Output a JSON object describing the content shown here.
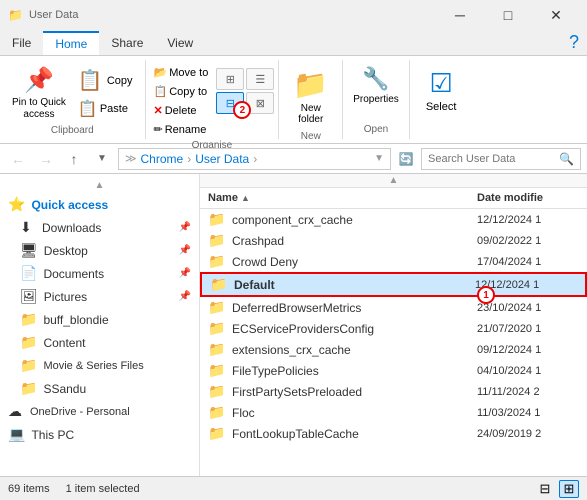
{
  "titleBar": {
    "title": "User Data",
    "quickAccessIcon": "📁",
    "controls": {
      "minimize": "─",
      "maximize": "□",
      "close": "✕"
    }
  },
  "ribbonTabs": [
    "File",
    "Home",
    "Share",
    "View"
  ],
  "activeTab": "Home",
  "ribbon": {
    "groups": [
      {
        "name": "clipboard",
        "label": "Clipboard",
        "buttons": [
          {
            "id": "pin-to-quick",
            "label": "Pin to Quick\naccess",
            "icon": "📌"
          },
          {
            "id": "copy",
            "label": "Copy",
            "icon": "📋"
          },
          {
            "id": "paste",
            "label": "Paste",
            "icon": "📋"
          }
        ]
      },
      {
        "name": "organise",
        "label": "Organise"
      },
      {
        "name": "new",
        "label": "New",
        "buttons": [
          {
            "id": "new-folder",
            "label": "New\nfolder",
            "icon": "📁"
          }
        ]
      },
      {
        "name": "open",
        "label": "Open",
        "buttons": [
          {
            "id": "properties",
            "label": "Properties",
            "icon": "🔧"
          }
        ]
      },
      {
        "name": "select",
        "label": "",
        "buttons": [
          {
            "id": "select-btn",
            "label": "Select",
            "icon": "☑"
          }
        ]
      }
    ]
  },
  "addressBar": {
    "path": [
      "Chrome",
      "User Data"
    ],
    "searchPlaceholder": "Search User Data",
    "searchIcon": "🔍"
  },
  "sidebar": {
    "items": [
      {
        "id": "quick-access",
        "label": "Quick access",
        "icon": "⭐",
        "type": "header",
        "expanded": true
      },
      {
        "id": "downloads",
        "label": "Downloads",
        "icon": "⬇",
        "pinned": true
      },
      {
        "id": "desktop",
        "label": "Desktop",
        "icon": "🖥",
        "pinned": true
      },
      {
        "id": "documents",
        "label": "Documents",
        "icon": "📄",
        "pinned": true
      },
      {
        "id": "pictures",
        "label": "Pictures",
        "icon": "🖼",
        "pinned": true
      },
      {
        "id": "buff-blondie",
        "label": "buff_blondie",
        "icon": "📁",
        "pinned": false
      },
      {
        "id": "content",
        "label": "Content",
        "icon": "📁",
        "pinned": false
      },
      {
        "id": "movie-series",
        "label": "Movie & Series Files",
        "icon": "📁",
        "pinned": false
      },
      {
        "id": "ssandu",
        "label": "SSandu",
        "icon": "📁",
        "pinned": false
      },
      {
        "id": "onedrive",
        "label": "OneDrive - Personal",
        "icon": "☁",
        "type": "header"
      },
      {
        "id": "this-pc",
        "label": "This PC",
        "icon": "💻",
        "type": "header"
      }
    ]
  },
  "fileList": {
    "columns": [
      {
        "id": "name",
        "label": "Name",
        "sortable": true
      },
      {
        "id": "date",
        "label": "Date modifie",
        "sortable": true
      }
    ],
    "files": [
      {
        "id": 1,
        "name": "component_crx_cache",
        "date": "12/12/2024 1",
        "icon": "📁",
        "selected": false
      },
      {
        "id": 2,
        "name": "Crashpad",
        "date": "09/02/2022 1",
        "icon": "📁",
        "selected": false
      },
      {
        "id": 3,
        "name": "Crowd Deny",
        "date": "17/04/2024 1",
        "icon": "📁",
        "selected": false
      },
      {
        "id": 4,
        "name": "Default",
        "date": "12/12/2024 1",
        "icon": "📁",
        "selected": true,
        "highlighted": true,
        "badge": "1"
      },
      {
        "id": 5,
        "name": "DeferredBrowserMetrics",
        "date": "23/10/2024 1",
        "icon": "📁",
        "selected": false
      },
      {
        "id": 6,
        "name": "ECServiceProvidersConfig",
        "date": "21/07/2020 1",
        "icon": "📁",
        "selected": false
      },
      {
        "id": 7,
        "name": "extensions_crx_cache",
        "date": "09/12/2024 1",
        "icon": "📁",
        "selected": false
      },
      {
        "id": 8,
        "name": "FileTypePolicies",
        "date": "04/10/2024 1",
        "icon": "📁",
        "selected": false
      },
      {
        "id": 9,
        "name": "FirstPartySetsPreloaded",
        "date": "11/11/2024 2",
        "icon": "📁",
        "selected": false
      },
      {
        "id": 10,
        "name": "Floc",
        "date": "11/03/2024 1",
        "icon": "📁",
        "selected": false
      },
      {
        "id": 11,
        "name": "FontLookupTableCache",
        "date": "24/09/2019 2",
        "icon": "📁",
        "selected": false
      }
    ]
  },
  "statusBar": {
    "itemCount": "69 items",
    "selectedCount": "1 item selected"
  }
}
